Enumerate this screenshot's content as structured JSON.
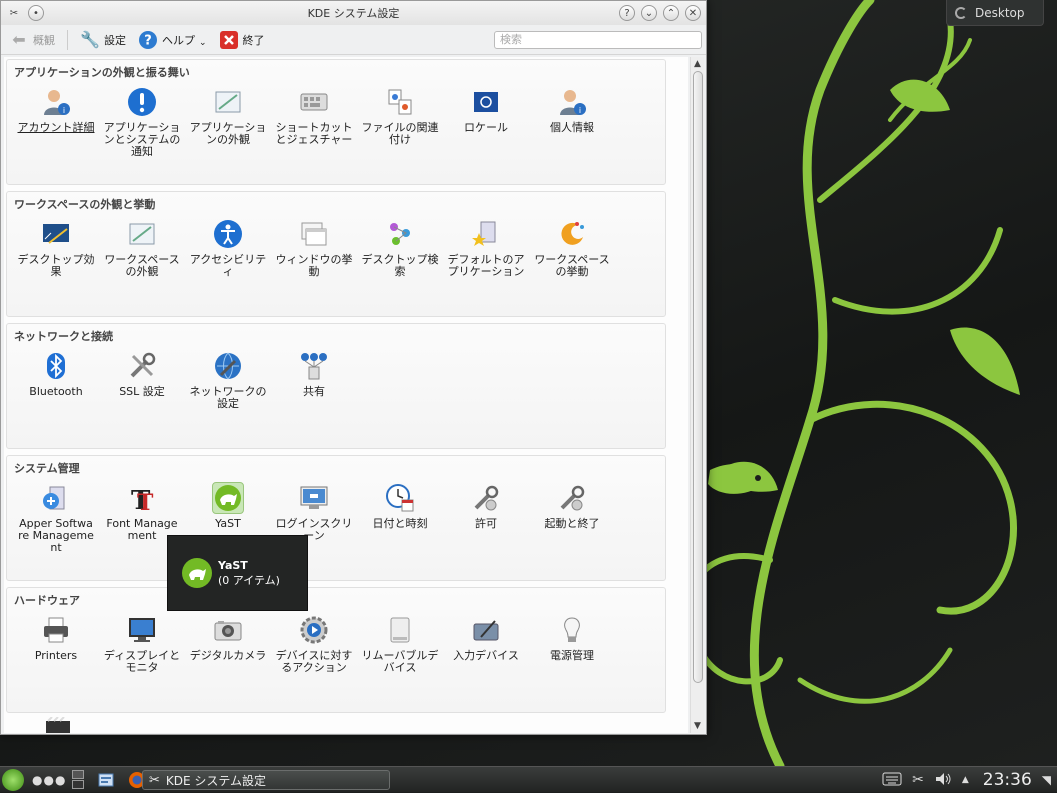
{
  "window": {
    "title": "KDE システム設定"
  },
  "toolbar": {
    "overview_label": "概観",
    "configure_label": "設定",
    "help_label": "ヘルプ",
    "quit_label": "終了",
    "search_placeholder": "検索"
  },
  "sections": [
    {
      "title": "アプリケーションの外観と振る舞い",
      "items": [
        {
          "label": "アカウント詳細",
          "icon": "user-info-icon"
        },
        {
          "label": "アプリケーションとシステムの通知",
          "icon": "notification-icon"
        },
        {
          "label": "アプリケーションの外観",
          "icon": "appearance-icon"
        },
        {
          "label": "ショートカットとジェスチャー",
          "icon": "keyboard-icon"
        },
        {
          "label": "ファイルの関連付け",
          "icon": "file-assoc-icon"
        },
        {
          "label": "ロケール",
          "icon": "locale-flag-icon"
        },
        {
          "label": "個人情報",
          "icon": "personal-info-icon"
        }
      ]
    },
    {
      "title": "ワークスペースの外観と挙動",
      "items": [
        {
          "label": "デスクトップ効果",
          "icon": "desktop-effects-icon"
        },
        {
          "label": "ワークスペースの外観",
          "icon": "workspace-appearance-icon"
        },
        {
          "label": "アクセシビリティ",
          "icon": "accessibility-icon"
        },
        {
          "label": "ウィンドウの挙動",
          "icon": "window-behavior-icon"
        },
        {
          "label": "デスクトップ検索",
          "icon": "desktop-search-icon"
        },
        {
          "label": "デフォルトのアプリケーション",
          "icon": "default-apps-icon"
        },
        {
          "label": "ワークスペースの挙動",
          "icon": "workspace-behavior-icon"
        }
      ]
    },
    {
      "title": "ネットワークと接続",
      "items": [
        {
          "label": "Bluetooth",
          "icon": "bluetooth-icon"
        },
        {
          "label": "SSL 設定",
          "icon": "ssl-tools-icon"
        },
        {
          "label": "ネットワークの設定",
          "icon": "network-settings-icon"
        },
        {
          "label": "共有",
          "icon": "sharing-icon"
        }
      ]
    },
    {
      "title": "システム管理",
      "items": [
        {
          "label": "Apper Software Management",
          "icon": "apper-icon"
        },
        {
          "label": "Font Management",
          "icon": "font-icon"
        },
        {
          "label": "YaST",
          "icon": "yast-icon"
        },
        {
          "label": "ログインスクリーン",
          "icon": "login-screen-icon"
        },
        {
          "label": "日付と時刻",
          "icon": "clock-icon"
        },
        {
          "label": "許可",
          "icon": "permissions-icon"
        },
        {
          "label": "起動と終了",
          "icon": "startup-icon"
        }
      ]
    },
    {
      "title": "ハードウェア",
      "items": [
        {
          "label": "Printers",
          "icon": "printer-icon"
        },
        {
          "label": "ディスプレイとモニタ",
          "icon": "monitor-icon"
        },
        {
          "label": "デジタルカメラ",
          "icon": "camera-icon"
        },
        {
          "label": "デバイスに対するアクション",
          "icon": "device-actions-icon"
        },
        {
          "label": "リムーバブルデバイス",
          "icon": "removable-icon"
        },
        {
          "label": "入力デバイス",
          "icon": "input-devices-icon"
        },
        {
          "label": "電源管理",
          "icon": "power-icon"
        }
      ]
    }
  ],
  "tooltip": {
    "title": "YaST",
    "subtitle": "(0 アイテム)"
  },
  "desktop": {
    "activity_label": "Desktop"
  },
  "taskbar": {
    "task_label": "KDE システム設定",
    "clock": "23:36"
  },
  "colors": {
    "accent_green": "#73ba25",
    "desktop_bg": "#1c1e1d"
  }
}
